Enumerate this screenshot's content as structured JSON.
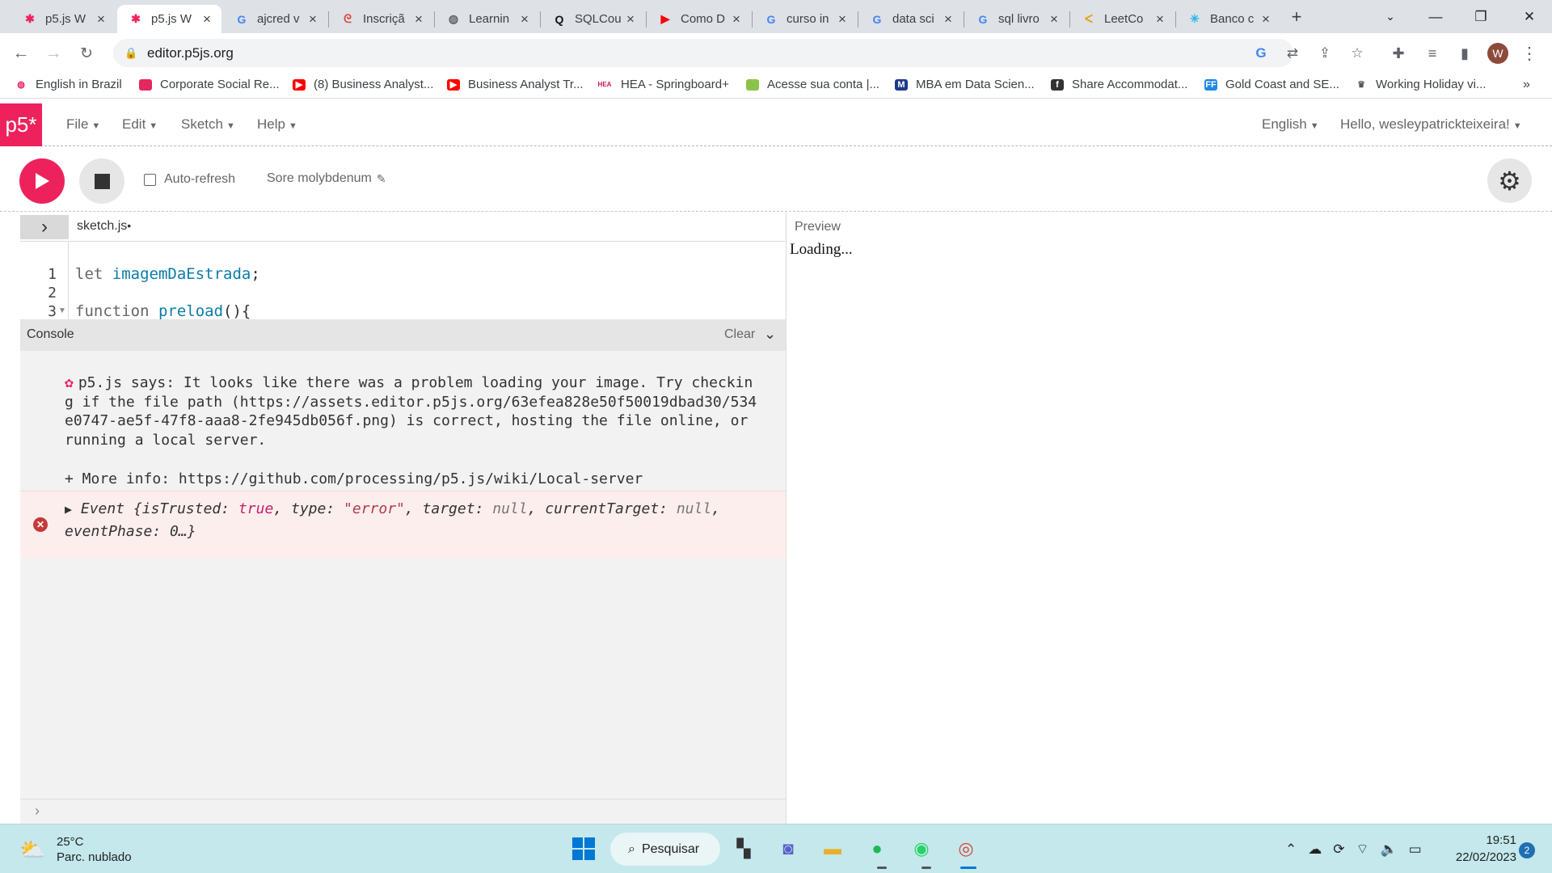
{
  "browser": {
    "tabs": [
      {
        "title": "p5.js W",
        "icon": "p5-asterisk-icon",
        "active": false
      },
      {
        "title": "p5.js W",
        "icon": "p5-asterisk-icon",
        "active": true
      },
      {
        "title": "ajcred v",
        "icon": "google-icon",
        "active": false
      },
      {
        "title": "Inscriçã",
        "icon": "swirl-icon",
        "active": false
      },
      {
        "title": "Learnin",
        "icon": "globe-icon",
        "active": false
      },
      {
        "title": "SQLCou",
        "icon": "q-icon",
        "active": false
      },
      {
        "title": "Como D",
        "icon": "youtube-icon",
        "active": false
      },
      {
        "title": "curso in",
        "icon": "google-icon",
        "active": false
      },
      {
        "title": "data sci",
        "icon": "google-icon",
        "active": false
      },
      {
        "title": "sql livro",
        "icon": "google-icon",
        "active": false
      },
      {
        "title": "LeetCo",
        "icon": "leetcode-icon",
        "active": false
      },
      {
        "title": "Banco c",
        "icon": "snowflake-icon",
        "active": false
      }
    ],
    "url": "editor.p5js.org",
    "profile_initial": "W",
    "bookmarks": [
      {
        "label": "English in Brazil",
        "icon": "globe-icon"
      },
      {
        "label": "Corporate Social Re...",
        "icon": "flag-icon"
      },
      {
        "label": "(8) Business Analyst...",
        "icon": "youtube-icon"
      },
      {
        "label": "Business Analyst Tr...",
        "icon": "youtube-icon"
      },
      {
        "label": "HEA - Springboard+",
        "icon": "hea-icon"
      },
      {
        "label": "Acesse sua conta |...",
        "icon": "leaf-icon"
      },
      {
        "label": "MBA em Data Scien...",
        "icon": "mba-icon"
      },
      {
        "label": "Share Accommodat...",
        "icon": "f-icon"
      },
      {
        "label": "Gold Coast and SE...",
        "icon": "ff-icon"
      },
      {
        "label": "Working Holiday vi...",
        "icon": "crest-icon"
      }
    ]
  },
  "p5": {
    "logo": "p5*",
    "menus": [
      "File",
      "Edit",
      "Sketch",
      "Help"
    ],
    "language": "English",
    "greeting": "Hello, wesleypatrickteixeira!",
    "auto_refresh_label": "Auto-refresh",
    "project_name": "Sore molybdenum",
    "file_name": "sketch.js",
    "code_lines": [
      {
        "n": "1",
        "text": "let imagemDaEstrada;"
      },
      {
        "n": "2",
        "text": ""
      },
      {
        "n": "3",
        "text": "function preload(){"
      }
    ],
    "console": {
      "title": "Console",
      "clear_label": "Clear",
      "message": "p5.js says: It looks like there was a problem loading your image. Try checking if the file path (https://assets.editor.p5js.org/63efea828e50f50019dbad30/534e0747-ae5f-47f8-aaa8-2fe945db056f.png) is correct, hosting the file online, or running a local server.",
      "more_info": "+ More info: https://github.com/processing/p5.js/wiki/Local-server",
      "error_prefix": "Event {isTrusted: ",
      "error_true": "true",
      "error_mid1": ", type: ",
      "error_type": "\"error\"",
      "error_mid2": ", target: ",
      "error_null1": "null",
      "error_mid3": ", currentTarget: ",
      "error_null2": "null",
      "error_tail": ", eventPhase: 0…}"
    },
    "preview_label": "Preview",
    "preview_status": "Loading..."
  },
  "taskbar": {
    "temperature": "25°C",
    "weather_desc": "Parc. nublado",
    "search_label": "Pesquisar",
    "time": "19:51",
    "date": "22/02/2023",
    "notification_count": "2"
  }
}
